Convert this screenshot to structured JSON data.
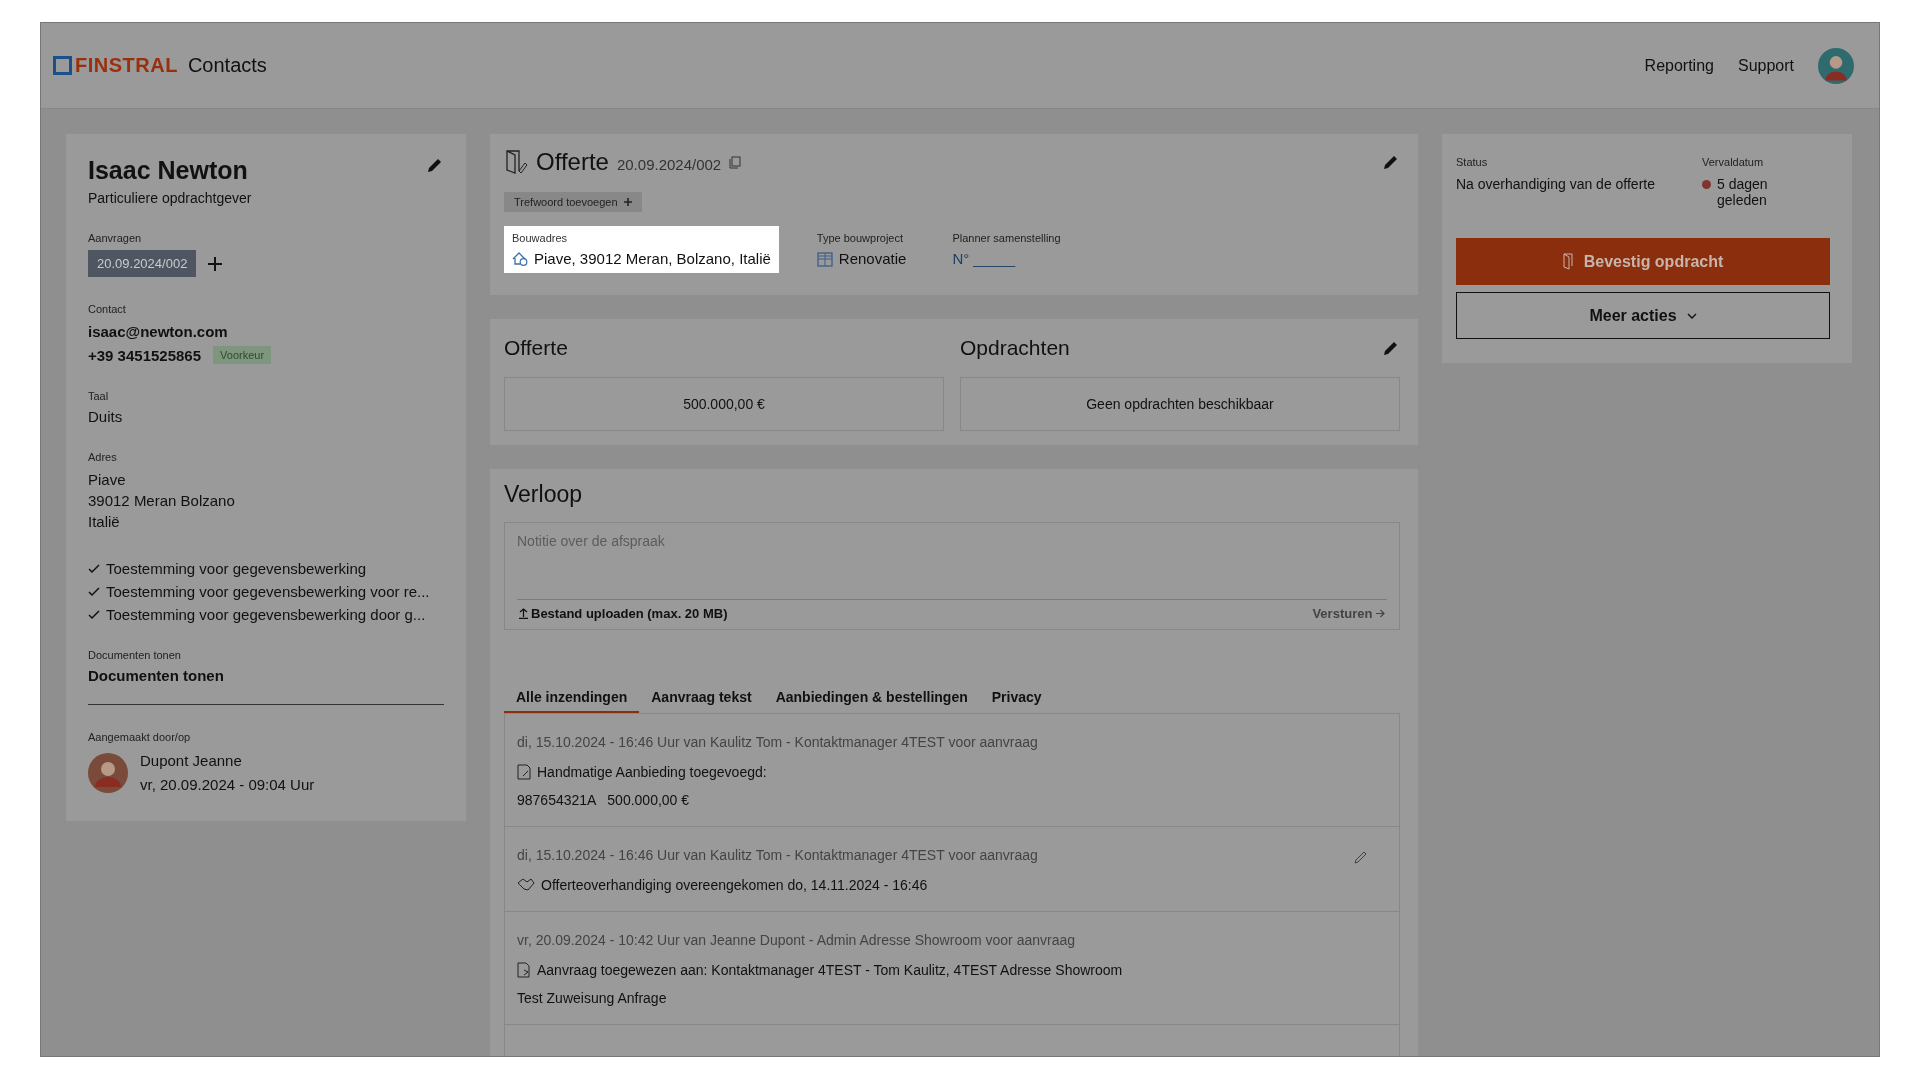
{
  "header": {
    "logo_text": "FINSTRAL",
    "app_name": "Contacts",
    "nav": [
      {
        "label": "Reporting"
      },
      {
        "label": "Support"
      }
    ]
  },
  "contact": {
    "name": "Isaac Newton",
    "role": "Particuliere opdrachtgever",
    "requests_label": "Aanvragen",
    "requests": [
      {
        "label": "20.09.2024/002"
      }
    ],
    "contact_label": "Contact",
    "email": "isaac@newton.com",
    "phone": "+39 3451525865",
    "phone_badge": "Voorkeur",
    "language_label": "Taal",
    "language": "Duits",
    "address_label": "Adres",
    "address_lines": [
      "Piave",
      "39012 Meran Bolzano",
      "Italië"
    ],
    "consents": [
      {
        "text": "Toestemming voor gegevensbewerking",
        "checked": true
      },
      {
        "text": "Toestemming voor gegevensbewerking voor re...",
        "checked": true
      },
      {
        "text": "Toestemming voor gegevensbewerking door g...",
        "checked": true
      }
    ],
    "documents_label": "Documenten tonen",
    "documents_link": "Documenten tonen",
    "created_label": "Aangemaakt door/op",
    "created_by": "Dupont Jeanne",
    "created_at": "vr, 20.09.2024 - 09:04 Uur"
  },
  "offer": {
    "title": "Offerte",
    "number": "20.09.2024/002",
    "tag_button": "Trefwoord toevoegen",
    "fields": [
      {
        "kind": "address",
        "label": "Bouwadres",
        "value": "Piave, 39012 Meran, Bolzano, Italië",
        "highlighted": true
      },
      {
        "kind": "type",
        "label": "Type bouwproject",
        "value": "Renovatie",
        "highlighted": false
      },
      {
        "kind": "planner",
        "label": "Planner samenstelling",
        "value": "N° _____",
        "highlighted": false
      }
    ]
  },
  "summary": [
    {
      "title": "Offerte",
      "value": "500.000,00 €",
      "editable": false
    },
    {
      "title": "Opdrachten",
      "value": "Geen opdrachten beschikbaar",
      "editable": true
    }
  ],
  "history": {
    "title": "Verloop",
    "note_placeholder": "Notitie over de afspraak",
    "upload": "Bestand uploaden (max. 20 MB)",
    "send": "Versturen",
    "tabs": [
      {
        "label": "Alle inzendingen",
        "selected": true
      },
      {
        "label": "Aanvraag tekst",
        "selected": false
      },
      {
        "label": "Aanbiedingen & bestellingen",
        "selected": false
      },
      {
        "label": "Privacy",
        "selected": false
      }
    ],
    "entries": [
      {
        "kind": "offer",
        "meta": "di, 15.10.2024 - 16:46 Uur van Kaulitz Tom - Kontaktmanager 4TEST voor aanvraag",
        "text": "Handmatige Aanbieding toegevoegd:",
        "detail": "987654321A   500.000,00 €",
        "editable": false
      },
      {
        "kind": "handover",
        "meta": "di, 15.10.2024 - 16:46 Uur van Kaulitz Tom - Kontaktmanager 4TEST voor aanvraag",
        "text": "Offerteoverhandiging overeengekomen do, 14.11.2024 - 16:46",
        "editable": true
      },
      {
        "kind": "assign",
        "meta": "vr, 20.09.2024 - 10:42 Uur van Jeanne Dupont - Admin Adresse Showroom voor aanvraag",
        "text": "Aanvraag toegewezen aan: Kontaktmanager 4TEST - Tom Kaulitz, 4TEST Adresse Showroom",
        "detail": "Test Zuweisung Anfrage",
        "editable": false
      }
    ]
  },
  "status": {
    "status_label": "Status",
    "status": "Na overhandiging van de offerte",
    "due_label": "Vervaldatum",
    "due": "5 dagen geleden",
    "primary_button": "Bevestig opdracht",
    "more_button": "Meer acties"
  }
}
